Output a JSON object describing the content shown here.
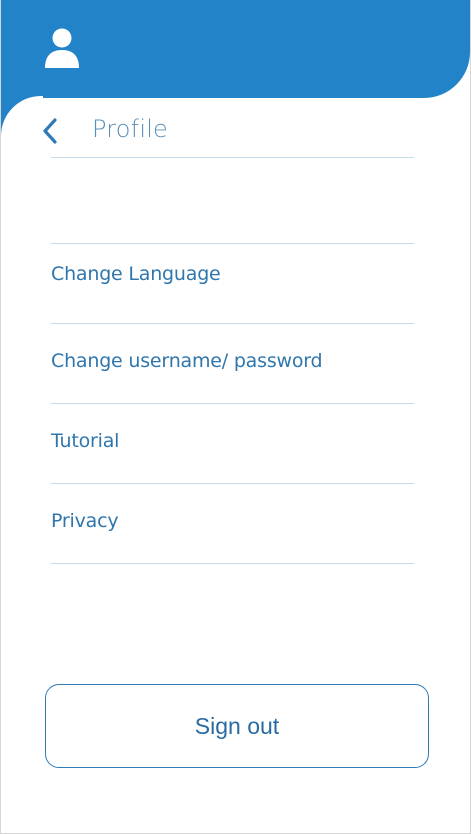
{
  "header": {
    "user_icon": "user-icon",
    "back_icon": "chevron-left-icon",
    "title": "Profile"
  },
  "menu": {
    "items": [
      {
        "label": "Change Language"
      },
      {
        "label": "Change username/ password"
      },
      {
        "label": "Tutorial"
      },
      {
        "label": "Privacy"
      }
    ]
  },
  "actions": {
    "sign_out_label": "Sign out"
  },
  "colors": {
    "header_blue": "#2383c9",
    "accent_blue": "#2f76ad",
    "title_blue": "#5a8fb8",
    "divider": "#c6dbe9"
  }
}
